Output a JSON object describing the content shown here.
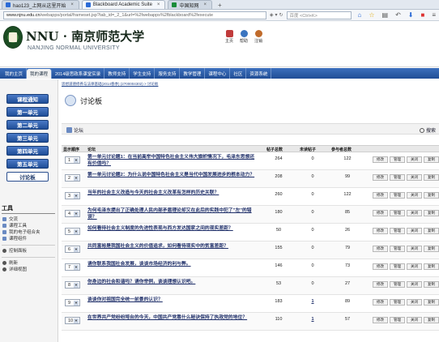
{
  "browser": {
    "tabs": [
      {
        "label": "hao123_上网从这里开始",
        "active": false
      },
      {
        "label": "Blackboard Academic Suite",
        "active": true
      },
      {
        "label": "中国知网",
        "active": false
      }
    ],
    "tab_close": "×",
    "tab_add": "+",
    "url_host": "www.njnu.edu.cn",
    "url_path": "/webapps/portal/frameset.jsp?tab_id=_2_1&url=%2fwebapps%2fblackboard%2fexecute",
    "search_placeholder": "百度 <Ctrl+K>"
  },
  "banner": {
    "logo_main": "NNU · 南京师范大学",
    "logo_sub": "NANJING NORMAL UNIVERSITY",
    "top_icons": [
      {
        "label": "主页",
        "icon": "home-icon"
      },
      {
        "label": "帮助",
        "icon": "help-icon"
      },
      {
        "label": "注销",
        "icon": "logout-icon"
      }
    ]
  },
  "nav": {
    "items": [
      "我的主页",
      "我的课程",
      "2014级思政系课堂实录",
      "教师支持",
      "学生支持",
      "服务支持",
      "教学管理",
      "课程中心",
      "社区",
      "资源系统"
    ],
    "active_index": 1
  },
  "breadcrumb": "思想道德修养与法律基础(2014春季) (2700004302) > 讨论板",
  "sidebar": {
    "buttons": [
      "课程通知",
      "第一单元",
      "第二单元",
      "第三单元",
      "第四单元",
      "第五单元",
      "讨论板"
    ],
    "active_index": 6,
    "tools_title": "工具",
    "tools": [
      "交流",
      "课程工具",
      "我的电子组合夹",
      "课程组件"
    ],
    "group2": [
      "控制面板"
    ],
    "group3": [
      "刷新",
      "详细视图"
    ]
  },
  "page": {
    "title": "讨论板",
    "forum_action": "论坛",
    "search_action": "搜索"
  },
  "table": {
    "headers": [
      "显示顺序",
      "论坛",
      "帖子总数",
      "未读帖子",
      "参与者总数"
    ],
    "buttons": [
      "修改",
      "管理",
      "关闭",
      "复制"
    ],
    "rows": [
      {
        "order": "1",
        "title": "第一单元讨论题1：在当前高举中国特色社会主义伟大旗帜情况下，毛泽东思想还有价值吗？",
        "total": "264",
        "unread": "0",
        "participants": "122"
      },
      {
        "order": "2",
        "title": "第一单元讨论题2：为什么说中国特色社会主义是当代中国发展进步的根本动力？",
        "total": "208",
        "unread": "0",
        "participants": "99"
      },
      {
        "order": "3",
        "title": "当年的社会主义改造与今天的社会主义改革有怎样的历史关联？",
        "total": "260",
        "unread": "0",
        "participants": "122"
      },
      {
        "order": "4",
        "title": "为何毛泽东提出了正确处理人民内部矛盾理论却又在此后的实践中犯了\"左\"的错误？",
        "total": "180",
        "unread": "0",
        "participants": "85"
      },
      {
        "order": "5",
        "title": "如何看待社会主义制度的先进性表现与西方发达国家之间的现实差距？",
        "total": "50",
        "unread": "0",
        "participants": "26"
      },
      {
        "order": "6",
        "title": "共同富裕是我国社会主义的价值追求，如何看待现实中的贫富差距？",
        "total": "155",
        "unread": "0",
        "participants": "79"
      },
      {
        "order": "7",
        "title": "请你联系我国社会发展，谈谈市场经济的利与弊。",
        "total": "146",
        "unread": "0",
        "participants": "73"
      },
      {
        "order": "8",
        "title": "你身边的社会和谐吗？请你举例，谈谈理想认识吧。",
        "total": "53",
        "unread": "0",
        "participants": "27"
      },
      {
        "order": "9",
        "title": "谈谈你对祖国完全统一前景的认识？",
        "total": "183",
        "unread": "1",
        "participants": "89"
      },
      {
        "order": "10",
        "title": "在世界共产党纷纷垮台的今天，中国共产党靠什么秘诀保持了执政党的地位？",
        "total": "110",
        "unread": "1",
        "participants": "57"
      }
    ]
  }
}
